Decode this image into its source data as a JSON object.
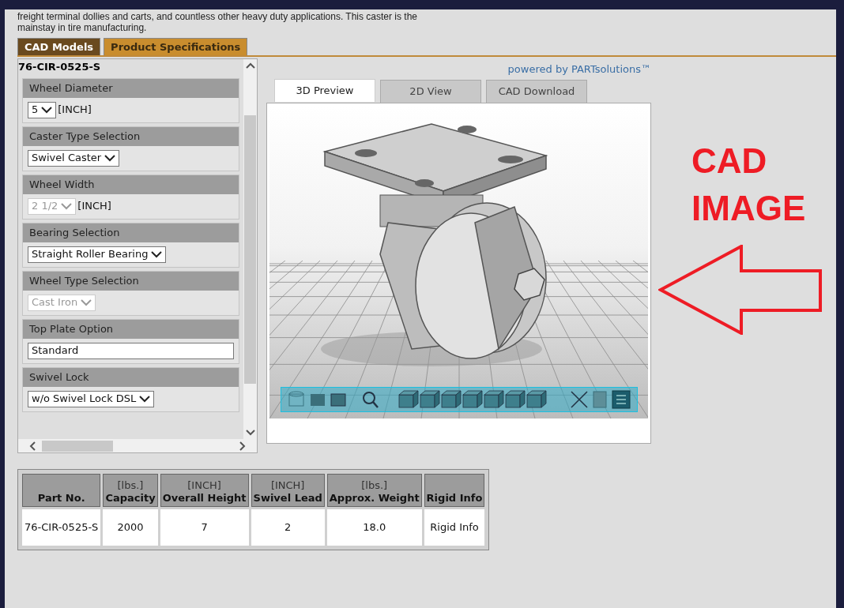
{
  "description": [
    "freight terminal dollies and carts, and countless other heavy duty applications. This caster is the",
    "mainstay in tire manufacturing."
  ],
  "tabs": [
    {
      "label": "CAD Models",
      "selected": true
    },
    {
      "label": "Product Specifications",
      "selected": false
    }
  ],
  "part_panel": {
    "title": "76-CIR-0525-S",
    "fields": [
      {
        "label": "Wheel Diameter",
        "kind": "select",
        "value": "5",
        "unit": "[INCH]",
        "disabled": false
      },
      {
        "label": "Caster Type Selection",
        "kind": "select",
        "value": "Swivel Caster",
        "disabled": false
      },
      {
        "label": "Wheel Width",
        "kind": "select",
        "value": "2 1/2",
        "unit": "[INCH]",
        "disabled": true
      },
      {
        "label": "Bearing Selection",
        "kind": "select",
        "value": "Straight Roller Bearing",
        "disabled": false
      },
      {
        "label": "Wheel Type Selection",
        "kind": "select",
        "value": "Cast Iron",
        "disabled": true
      },
      {
        "label": "Top Plate Option",
        "kind": "text",
        "value": "Standard",
        "disabled": false
      },
      {
        "label": "Swivel Lock",
        "kind": "select",
        "value": "w/o Swivel Lock DSL",
        "disabled": false
      }
    ]
  },
  "viewer": {
    "powered_by": "powered by PARTsolutions™",
    "tabs": [
      {
        "label": "3D Preview",
        "selected": true
      },
      {
        "label": "2D View",
        "selected": false
      },
      {
        "label": "CAD Download",
        "selected": false
      }
    ]
  },
  "annotation": {
    "lines": [
      "CAD",
      "IMAGE"
    ]
  },
  "table": {
    "columns": [
      {
        "name": "Part No."
      },
      {
        "unit": "[lbs.]",
        "name": "Capacity"
      },
      {
        "unit": "[INCH]",
        "name": "Overall Height"
      },
      {
        "unit": "[INCH]",
        "name": "Swivel Lead"
      },
      {
        "unit": "[lbs.]",
        "name": "Approx. Weight"
      },
      {
        "name": "Rigid Info"
      }
    ],
    "rows": [
      [
        "76-CIR-0525-S",
        "2000",
        "7",
        "2",
        "18.0",
        "Rigid Info"
      ]
    ]
  }
}
